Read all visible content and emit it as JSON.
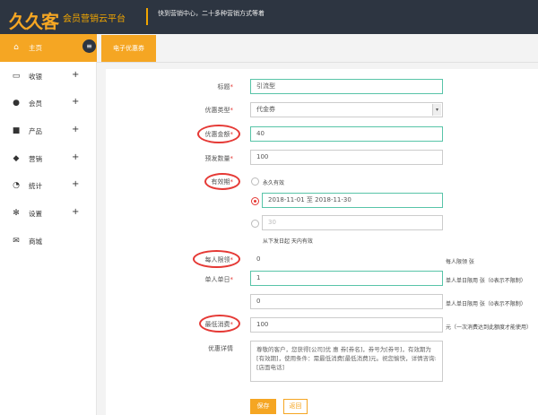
{
  "header": {
    "logo_text": "久久客",
    "platform_name": "会员营销云平台",
    "slogan": "快到营销中心，二十多种营销方式等着"
  },
  "sidebar": {
    "items": [
      {
        "label": "主页",
        "icon": "home-icon",
        "active": true
      },
      {
        "label": "收银",
        "icon": "monitor-icon",
        "expand": "+"
      },
      {
        "label": "会员",
        "icon": "user-icon",
        "expand": "+"
      },
      {
        "label": "产品",
        "icon": "box-icon",
        "expand": "+"
      },
      {
        "label": "营销",
        "icon": "tag-icon",
        "expand": "+"
      },
      {
        "label": "统计",
        "icon": "pie-chart-icon",
        "expand": "+"
      },
      {
        "label": "设置",
        "icon": "gear-icon",
        "expand": "+"
      },
      {
        "label": "商城",
        "icon": "envelope-icon"
      }
    ]
  },
  "tab": {
    "label": "电子优惠券"
  },
  "form": {
    "title": {
      "label": "标题",
      "value": "引流型"
    },
    "coupon_type": {
      "label": "优惠类型",
      "value": "代金券"
    },
    "discount_amount": {
      "label": "优惠金额",
      "value": "40"
    },
    "issue_quantity": {
      "label": "预发数量",
      "value": "100"
    },
    "validity": {
      "label": "有效期",
      "option_forever": "永久有效",
      "date_range": "2018-11-01 至 2018-11-30",
      "days_placeholder": "30",
      "days_hint": "从下发日起 天内有效"
    },
    "per_person_limit": {
      "label": "每人限领",
      "value": "0",
      "hint": "每人限领 张"
    },
    "single_person_daily": {
      "label": "单人单日",
      "value": "1",
      "hint": "单人单日限用 张（0表示不限制）"
    },
    "single_bill": {
      "value": "0",
      "hint": "单人单日限用 张（0表示不限制）"
    },
    "min_spend": {
      "label": "最低消费",
      "value": "100",
      "hint": "元（一次消费达到此额度才能使用）"
    },
    "details": {
      "label": "优惠详情",
      "value": "尊敬的客户，您获得[公司]优 惠 券[券名]，券号为[券号]，有效期为[有效期]，使用条件：需最低消费[最低消费]元。祝您愉快，详情咨询:[店面电话]"
    },
    "required_mark": "*",
    "save_label": "保存",
    "back_label": "返回"
  },
  "colors": {
    "accent": "#f5a623",
    "header_bg": "#2d3541",
    "highlight_ring": "#e53935",
    "focus_border": "#58c4a8"
  }
}
